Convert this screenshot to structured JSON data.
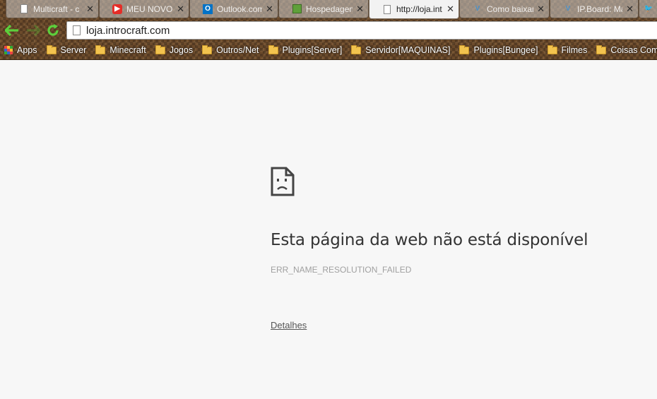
{
  "tabs": [
    {
      "label": "Multicraft - c",
      "favicon": "page-icon",
      "active": false
    },
    {
      "label": "MEU NOVO",
      "favicon": "youtube-icon",
      "active": false
    },
    {
      "label": "Outlook.com",
      "favicon": "outlook-icon",
      "active": false
    },
    {
      "label": "Hospedagem",
      "favicon": "minecraft-block-icon",
      "active": false
    },
    {
      "label": "http://loja.int",
      "favicon": "page-icon",
      "active": true
    },
    {
      "label": "Como baixar",
      "favicon": "v-icon",
      "active": false
    },
    {
      "label": "IP.Board: Ma",
      "favicon": "v-icon",
      "active": false
    },
    {
      "label": "",
      "favicon": "twitter-icon",
      "active": false
    }
  ],
  "toolbar": {
    "back_icon": "back-arrow-icon",
    "forward_icon": "forward-arrow-icon",
    "reload_icon": "reload-icon",
    "url": "loja.introcraft.com"
  },
  "bookmarks": [
    {
      "label": "Apps",
      "icon": "apps-grid-icon"
    },
    {
      "label": "Server",
      "icon": "folder-icon"
    },
    {
      "label": "Minecraft",
      "icon": "folder-icon"
    },
    {
      "label": "Jogos",
      "icon": "folder-icon"
    },
    {
      "label": "Outros/Net",
      "icon": "folder-icon"
    },
    {
      "label": "Plugins[Server]",
      "icon": "folder-icon"
    },
    {
      "label": "Servidor[MAQUINAS]",
      "icon": "folder-icon"
    },
    {
      "label": "Plugins[Bungee]",
      "icon": "folder-icon"
    },
    {
      "label": "Filmes",
      "icon": "folder-icon"
    },
    {
      "label": "Coisas Comprar",
      "icon": "folder-icon"
    }
  ],
  "error": {
    "icon": "sad-page-icon",
    "title": "Esta página da web não está disponível",
    "code": "ERR_NAME_RESOLUTION_FAILED",
    "details_link": "Detalhes"
  },
  "colors": {
    "nav_green": "#5ccf3c",
    "page_background": "#f7f7f7",
    "title_text": "#333333",
    "code_text": "#a0a0a0"
  }
}
